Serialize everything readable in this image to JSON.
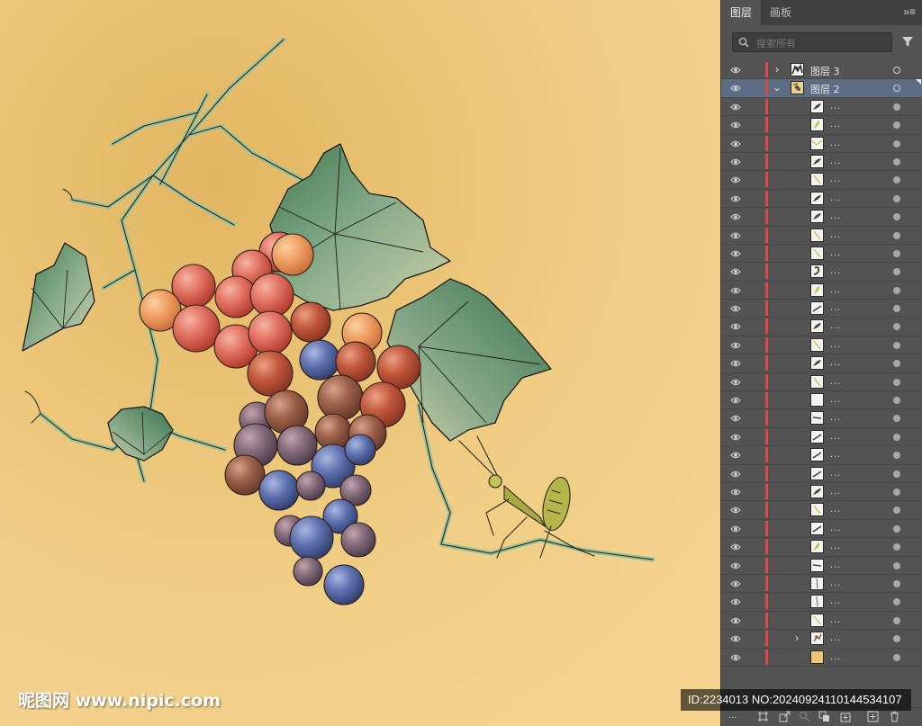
{
  "panel": {
    "tabs": [
      {
        "label": "图层",
        "active": true
      },
      {
        "label": "画板",
        "active": false
      }
    ],
    "menu_label": "»≡",
    "search": {
      "placeholder": "搜索所有",
      "value": ""
    },
    "layers": [
      {
        "name": "图层 3",
        "kind": "layer",
        "expanded": false,
        "thumb": "ink-sketch"
      },
      {
        "name": "图层 2",
        "kind": "layer",
        "expanded": true,
        "selected": true,
        "thumb": "grapes"
      },
      {
        "name": "...",
        "kind": "path",
        "thumb": "leaf-dark"
      },
      {
        "name": "...",
        "kind": "path",
        "thumb": "leaf-yellow"
      },
      {
        "name": "...",
        "kind": "path",
        "thumb": "vee-yellow"
      },
      {
        "name": "...",
        "kind": "path",
        "thumb": "leaf-dark"
      },
      {
        "name": "...",
        "kind": "path",
        "thumb": "stroke-yellow"
      },
      {
        "name": "...",
        "kind": "path",
        "thumb": "leaf-dark"
      },
      {
        "name": "...",
        "kind": "path",
        "thumb": "leaf-dark"
      },
      {
        "name": "...",
        "kind": "path",
        "thumb": "stroke-yellow"
      },
      {
        "name": "...",
        "kind": "path",
        "thumb": "stroke-yellow"
      },
      {
        "name": "...",
        "kind": "path",
        "thumb": "curl-dark"
      },
      {
        "name": "...",
        "kind": "path",
        "thumb": "leaf-yellow"
      },
      {
        "name": "...",
        "kind": "path",
        "thumb": "stroke-dark"
      },
      {
        "name": "...",
        "kind": "path",
        "thumb": "leaf-dark"
      },
      {
        "name": "...",
        "kind": "path",
        "thumb": "stroke-yellow"
      },
      {
        "name": "...",
        "kind": "path",
        "thumb": "leaf-dark"
      },
      {
        "name": "...",
        "kind": "path",
        "thumb": "stroke-yellow"
      },
      {
        "name": "...",
        "kind": "path",
        "thumb": "blank"
      },
      {
        "name": "...",
        "kind": "path",
        "thumb": "dash-dark"
      },
      {
        "name": "...",
        "kind": "path",
        "thumb": "stroke-dark"
      },
      {
        "name": "...",
        "kind": "path",
        "thumb": "stroke-dark"
      },
      {
        "name": "...",
        "kind": "path",
        "thumb": "stroke-dark"
      },
      {
        "name": "...",
        "kind": "path",
        "thumb": "leaf-dark"
      },
      {
        "name": "...",
        "kind": "path",
        "thumb": "stroke-yellow"
      },
      {
        "name": "...",
        "kind": "path",
        "thumb": "stroke-dark"
      },
      {
        "name": "...",
        "kind": "path",
        "thumb": "leaf-yellow"
      },
      {
        "name": "...",
        "kind": "path",
        "thumb": "dash-dark"
      },
      {
        "name": "...",
        "kind": "path",
        "thumb": "stroke-thin"
      },
      {
        "name": "...",
        "kind": "path",
        "thumb": "stroke-thin"
      },
      {
        "name": "...",
        "kind": "path",
        "thumb": "stroke-yellow"
      },
      {
        "name": "...",
        "kind": "group",
        "expanded": false,
        "thumb": "mantis"
      },
      {
        "name": "...",
        "kind": "path",
        "thumb": "solid-tan"
      }
    ],
    "footer_label": "...",
    "footer_icons": [
      "artboard-icon",
      "export-icon",
      "locate-object-icon",
      "clipping-mask-icon",
      "new-sublayer-icon",
      "new-layer-icon",
      "delete-icon"
    ]
  },
  "watermark": {
    "left_text": "昵图网 www.nipic.com",
    "right_text": "ID:2234013 NO:20240924110144534107"
  },
  "colors": {
    "canvas_bg": "#f0cf86",
    "panel_bg": "#535353",
    "selected_row": "#5d6d86",
    "layer_color_bar": "#d94a46"
  }
}
